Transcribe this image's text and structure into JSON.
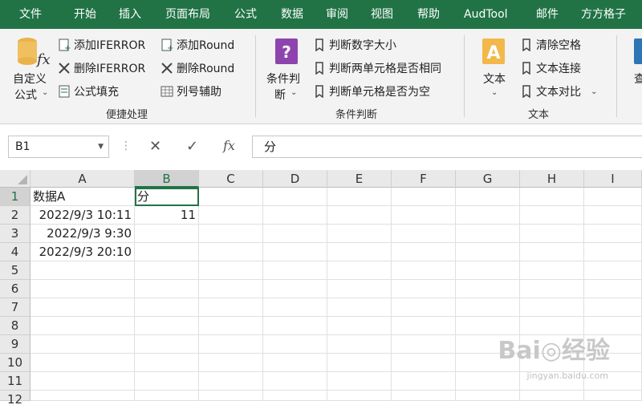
{
  "menu": {
    "tabs": [
      "文件",
      "开始",
      "插入",
      "页面布局",
      "公式",
      "数据",
      "审阅",
      "视图",
      "帮助",
      "AudTool",
      "邮件",
      "方方格子"
    ]
  },
  "ribbon": {
    "group1": {
      "big_button_line1": "自定义",
      "big_button_line2": "公式",
      "btn_add_iferror": "添加IFERROR",
      "btn_del_iferror": "删除IFERROR",
      "btn_formula_fill": "公式填充",
      "btn_add_round": "添加Round",
      "btn_del_round": "删除Round",
      "btn_col_helper": "列号辅助",
      "label": "便捷处理"
    },
    "group2": {
      "big_button_line1": "条件判",
      "big_button_line2": "断",
      "btn_num_size": "判断数字大小",
      "btn_two_same": "判断两单元格是否相同",
      "btn_cell_empty": "判断单元格是否为空",
      "label": "条件判断"
    },
    "group3": {
      "big_button": "文本",
      "btn_clear_space": "清除空格",
      "btn_text_join": "文本连接",
      "btn_text_compare": "文本对比",
      "label": "文本"
    },
    "group4": {
      "partial_label": "查"
    }
  },
  "formula_bar": {
    "name_box": "B1",
    "formula": "分",
    "fx": "fx"
  },
  "sheet": {
    "columns": [
      "A",
      "B",
      "C",
      "D",
      "E",
      "F",
      "G",
      "H",
      "I"
    ],
    "rows": [
      "1",
      "2",
      "3",
      "4",
      "5",
      "6",
      "7",
      "8",
      "9",
      "10",
      "11",
      "12"
    ],
    "cells": {
      "A1": "数据A",
      "B1": "分",
      "A2": "2022/9/3 10:11",
      "B2": "11",
      "A3": "2022/9/3 9:30",
      "A4": "2022/9/3 20:10"
    }
  },
  "watermark": {
    "main": "Bai◎经验",
    "sub": "jingyan.baidu.com"
  },
  "colors": {
    "accent": "#217346"
  }
}
